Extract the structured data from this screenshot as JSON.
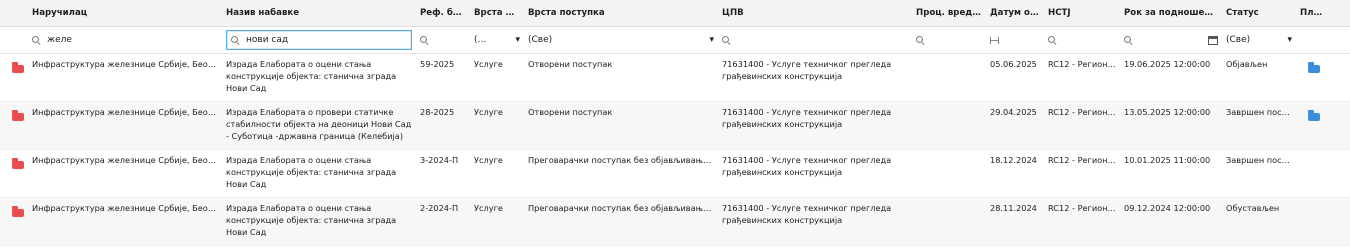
{
  "columns": {
    "orderer": "Наручилац",
    "procurement_name": "Назив набавке",
    "ref_number": "Реф. број",
    "type_short": "Врста п…",
    "procedure_type": "Врста поступка",
    "cpv": "ЦПВ",
    "estimated_value": "Проц. вредност",
    "publish_date": "Датум обј…",
    "nstj": "НСТЈ",
    "deadline": "Рок за подношење",
    "status": "Статус",
    "plan": "План"
  },
  "filters": {
    "orderer": "желе",
    "procurement_name": "нови сад",
    "type_short": "(…",
    "procedure_type": "(Све)",
    "status": "(Све)"
  },
  "rows": [
    {
      "orderer": "Инфраструктура железнице Србије, Београд",
      "procurement_name": "Израда Елабората о оцени стања конструкције објекта: станична зграда Нови Сад",
      "ref_number": "59-2025",
      "type_short": "Услуге",
      "procedure_type": "Отворени поступак",
      "cpv": "71631400 - Услуге техничког прегледа грађевинских конструкција",
      "estimated_value": "",
      "publish_date": "05.06.2025",
      "nstj": "RC12 - Регион …",
      "deadline": "19.06.2025 12:00:00",
      "status": "Објављен",
      "has_plan": true
    },
    {
      "orderer": "Инфраструктура железнице Србије, Београд",
      "procurement_name": "Израда Елабората о провери статичке стабилности објекта на деоници Нови Сад - Суботица -државна граница (Келебија)",
      "ref_number": "28-2025",
      "type_short": "Услуге",
      "procedure_type": "Отворени поступак",
      "cpv": "71631400 - Услуге техничког прегледа грађевинских конструкција",
      "estimated_value": "",
      "publish_date": "29.04.2025",
      "nstj": "RC12 - Регион …",
      "deadline": "13.05.2025 12:00:00",
      "status": "Завршен пост…",
      "has_plan": true
    },
    {
      "orderer": "Инфраструктура железнице Србије, Београд",
      "procurement_name": "Израда Елабората о оцени стања конструкције објекта: станична зграда Нови Сад",
      "ref_number": "3-2024-П",
      "type_short": "Услуге",
      "procedure_type": "Преговарачки поступак без објављивања ј…",
      "cpv": "71631400 - Услуге техничког прегледа грађевинских конструкција",
      "estimated_value": "",
      "publish_date": "18.12.2024",
      "nstj": "RC12 - Регион …",
      "deadline": "10.01.2025 11:00:00",
      "status": "Завршен пост…",
      "has_plan": false
    },
    {
      "orderer": "Инфраструктура железнице Србије, Београд",
      "procurement_name": "Израда Елабората о оцени стања конструкције објекта: станична зграда Нови Сад",
      "ref_number": "2-2024-П",
      "type_short": "Услуге",
      "procedure_type": "Преговарачки поступак без објављивања ј…",
      "cpv": "71631400 - Услуге техничког прегледа грађевинских конструкција",
      "estimated_value": "",
      "publish_date": "28.11.2024",
      "nstj": "RC12 - Регион …",
      "deadline": "09.12.2024 12:00:00",
      "status": "Обустављен",
      "has_plan": false
    }
  ]
}
